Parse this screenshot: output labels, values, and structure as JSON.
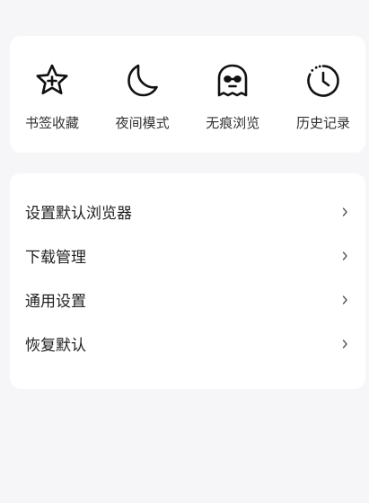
{
  "quick_actions": [
    {
      "label": "书签收藏",
      "icon": "star-icon"
    },
    {
      "label": "夜间模式",
      "icon": "moon-icon"
    },
    {
      "label": "无痕浏览",
      "icon": "ghost-icon"
    },
    {
      "label": "历史记录",
      "icon": "history-clock-icon"
    }
  ],
  "menu": [
    {
      "label": "设置默认浏览器"
    },
    {
      "label": "下载管理"
    },
    {
      "label": "通用设置"
    },
    {
      "label": "恢复默认"
    }
  ],
  "colors": {
    "background": "#f6f6f8",
    "card": "#ffffff",
    "text": "#222222",
    "icon": "#111111",
    "chevron": "#555555"
  }
}
